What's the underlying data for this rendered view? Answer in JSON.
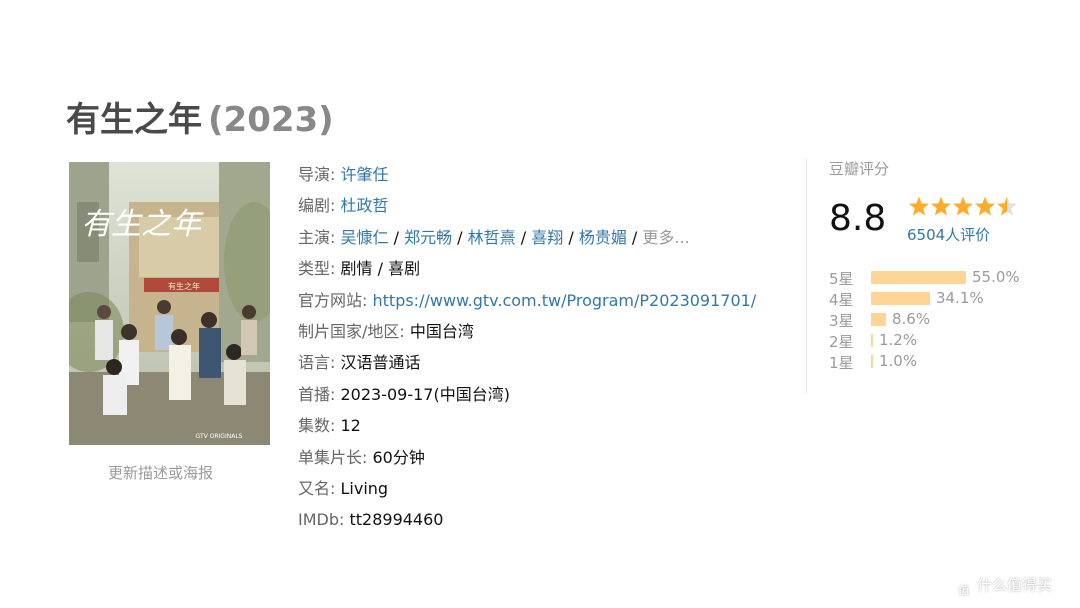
{
  "movie": {
    "title": "有生之年",
    "year": "(2023)"
  },
  "poster": {
    "title_art": "有生之年",
    "bottom_text": "GTV ORIGINALS"
  },
  "update_link": "更新描述或海报",
  "info": {
    "director": {
      "label": "导演",
      "value": "许肇任"
    },
    "writer": {
      "label": "编剧",
      "value": "杜政哲"
    },
    "cast": {
      "label": "主演",
      "names": [
        "吴慷仁",
        "郑元畅",
        "林哲熹",
        "喜翔",
        "杨贵媚"
      ],
      "more": "更多..."
    },
    "genre": {
      "label": "类型",
      "values": [
        "剧情",
        "喜剧"
      ]
    },
    "site": {
      "label": "官方网站",
      "value": "https://www.gtv.com.tw/Program/P2023091701/"
    },
    "country": {
      "label": "制片国家/地区",
      "value": "中国台湾"
    },
    "language": {
      "label": "语言",
      "value": "汉语普通话"
    },
    "premiere": {
      "label": "首播",
      "value": "2023-09-17(中国台湾)"
    },
    "episodes": {
      "label": "集数",
      "value": "12"
    },
    "runtime": {
      "label": "单集片长",
      "value": "60分钟"
    },
    "aka": {
      "label": "又名",
      "value": "Living"
    },
    "imdb": {
      "label": "IMDb",
      "value": "tt28994460"
    }
  },
  "rating": {
    "label": "豆瓣评分",
    "score": "8.8",
    "stars_out_of_5": 4.5,
    "count_text": "6504人评价",
    "breakdown": [
      {
        "label": "5星",
        "pct_text": "55.0%",
        "pct": 55.0
      },
      {
        "label": "4星",
        "pct_text": "34.1%",
        "pct": 34.1
      },
      {
        "label": "3星",
        "pct_text": "8.6%",
        "pct": 8.6
      },
      {
        "label": "2星",
        "pct_text": "1.2%",
        "pct": 1.2
      },
      {
        "label": "1星",
        "pct_text": "1.0%",
        "pct": 1.0
      }
    ]
  },
  "colors": {
    "link": "#3377aa",
    "star": "#ffac2d",
    "bar": "#ffd596"
  },
  "watermark": "什么值得买"
}
